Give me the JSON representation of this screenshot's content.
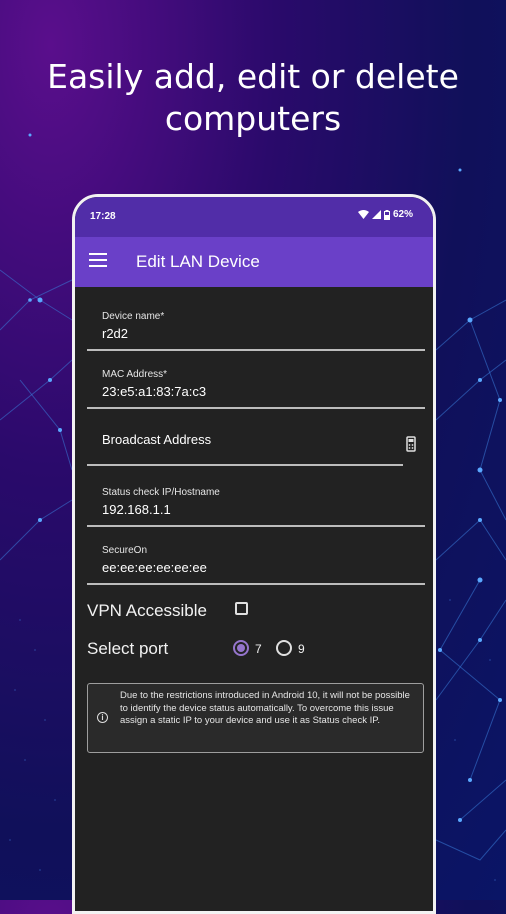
{
  "headline": "Easily add, edit or delete computers",
  "colors": {
    "statusbar": "#512da8",
    "appbar": "#6a40c8",
    "accent": "#9575cd",
    "content_bg": "#222222"
  },
  "statusbar": {
    "time": "17:28",
    "icons": [
      "wifi-icon",
      "signal-icon",
      "battery-icon"
    ],
    "battery": "62%"
  },
  "appbar": {
    "menu_icon": "menu-icon",
    "title": "Edit LAN Device"
  },
  "form": {
    "device_name": {
      "label": "Device name*",
      "value": "r2d2"
    },
    "mac": {
      "label": "MAC Address*",
      "value": "23:e5:a1:83:7a:c3"
    },
    "broadcast": {
      "placeholder": "Broadcast Address",
      "icon": "calculator-icon"
    },
    "status_ip": {
      "label": "Status check IP/Hostname",
      "value": "192.168.1.1"
    },
    "secureon": {
      "label": "SecureOn",
      "value": "ee:ee:ee:ee:ee:ee"
    },
    "vpn": {
      "label": "VPN Accessible",
      "checked": false
    },
    "port": {
      "label": "Select port",
      "options": [
        "7",
        "9"
      ],
      "selected": "7"
    }
  },
  "notice": {
    "icon": "info-icon",
    "text": "Due to the restrictions introduced in Android 10, it will not be possible to identify the device status automatically. To overcome this issue assign a static IP to your device and use it as Status check IP."
  }
}
